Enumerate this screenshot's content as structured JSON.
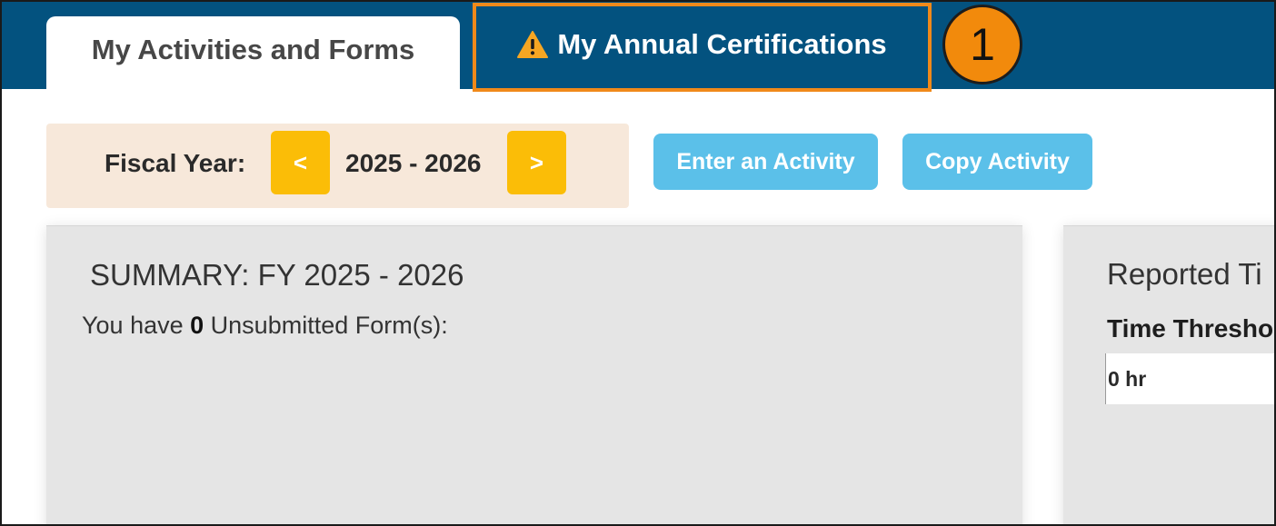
{
  "tabs": {
    "activities_label": "My Activities and Forms",
    "certifications_label": "My Annual Certifications",
    "certifications_icon": "warning-icon"
  },
  "callout": {
    "number": "1",
    "color": "#f28a0c"
  },
  "fiscal_year": {
    "label": "Fiscal Year:",
    "prev_label": "<",
    "value": "2025 - 2026",
    "next_label": ">"
  },
  "actions": {
    "enter_label": "Enter an Activity",
    "copy_label": "Copy Activity"
  },
  "summary": {
    "title": "SUMMARY: FY 2025 - 2026",
    "prefix": "You have ",
    "count": "0",
    "suffix": " Unsubmitted Form(s):"
  },
  "reported": {
    "title": "Reported Ti",
    "threshold_label": "Time Thresho",
    "threshold_value": "0 hr"
  },
  "colors": {
    "nav_bg": "#03527f",
    "highlight": "#f0891a",
    "warning": "#f5a623",
    "fy_button": "#fbbd07",
    "action_button": "#5bc0e9",
    "fy_box": "#f7e8da",
    "panel": "#e5e5e5"
  }
}
